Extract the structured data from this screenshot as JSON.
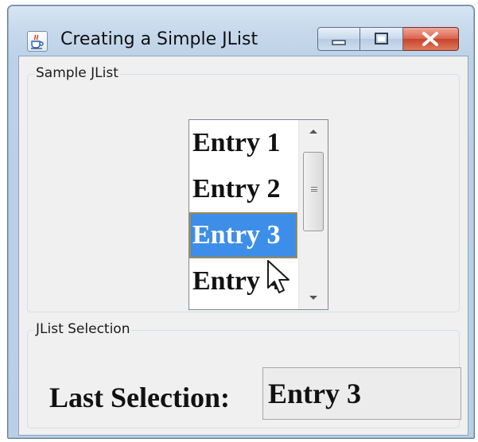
{
  "window": {
    "title": "Creating a Simple JList",
    "icon": "java-cup-icon"
  },
  "title_buttons": {
    "minimize_icon": "minimize-icon",
    "maximize_icon": "maximize-icon",
    "close_icon": "close-icon"
  },
  "sample_group": {
    "label": "Sample JList",
    "items": [
      "Entry 1",
      "Entry 2",
      "Entry 3",
      "Entry 4"
    ],
    "selected_index": 2
  },
  "selection_group": {
    "label": "JList Selection",
    "prompt": "Last Selection:",
    "value": "Entry 3"
  },
  "colors": {
    "selection_bg": "#3d8ee8",
    "close_button": "#c8432c"
  }
}
